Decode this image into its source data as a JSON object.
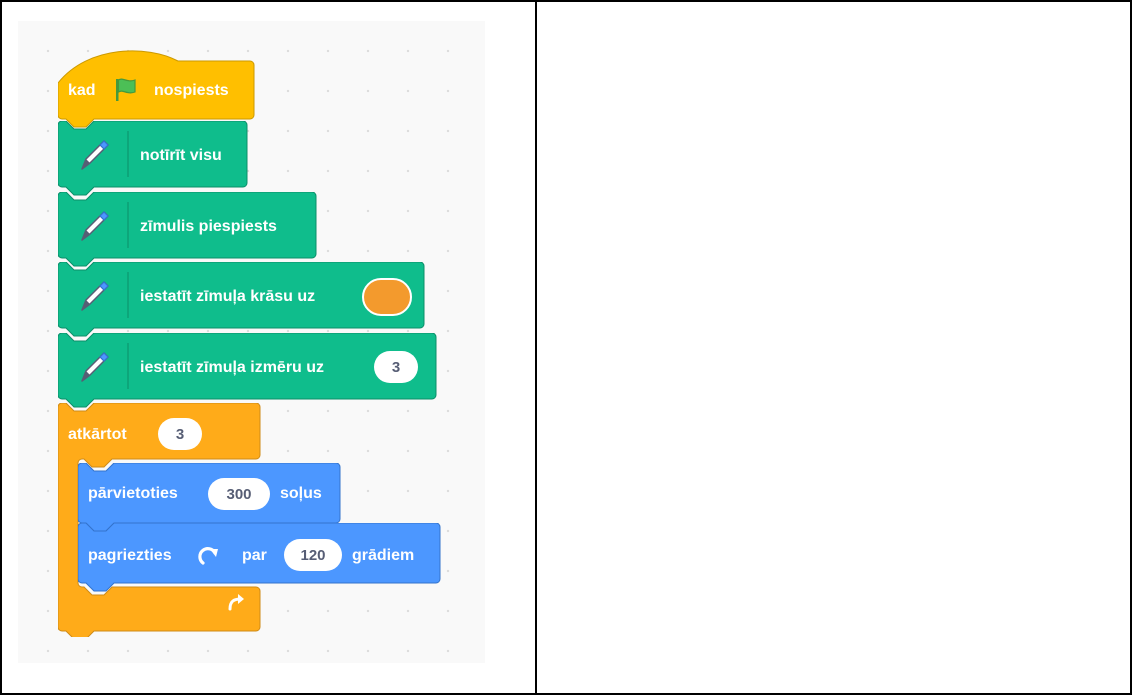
{
  "hat": {
    "prefix": "kad",
    "suffix": "nospiests",
    "flag_icon": "green-flag-icon"
  },
  "pen_blocks": [
    {
      "label": "notīrīt visu",
      "icon": "pen-icon"
    },
    {
      "label": "zīmulis piespiests",
      "icon": "pen-icon"
    },
    {
      "label": "iestatīt zīmuļa krāsu uz",
      "icon": "pen-icon",
      "color_value": "#f39a2d"
    },
    {
      "label": "iestatīt zīmuļa izmēru uz",
      "icon": "pen-icon",
      "value": "3"
    }
  ],
  "repeat": {
    "label": "atkārtot",
    "value": "3",
    "loop_icon": "loop-arrow-icon"
  },
  "move": {
    "prefix": "pārvietoties",
    "value": "300",
    "suffix": "soļus"
  },
  "turn": {
    "prefix": "pagriezties",
    "arrow_icon": "rotate-clockwise-icon",
    "middle": "par",
    "value": "120",
    "suffix": "grādiem"
  },
  "colors": {
    "events": "#ffbf00",
    "events_dark": "#cc9900",
    "control": "#ffab19",
    "control_dark": "#cf8b17",
    "pen": "#0fbd8c",
    "pen_dark": "#0b8e69",
    "motion": "#4c97ff",
    "motion_dark": "#3373cc"
  }
}
